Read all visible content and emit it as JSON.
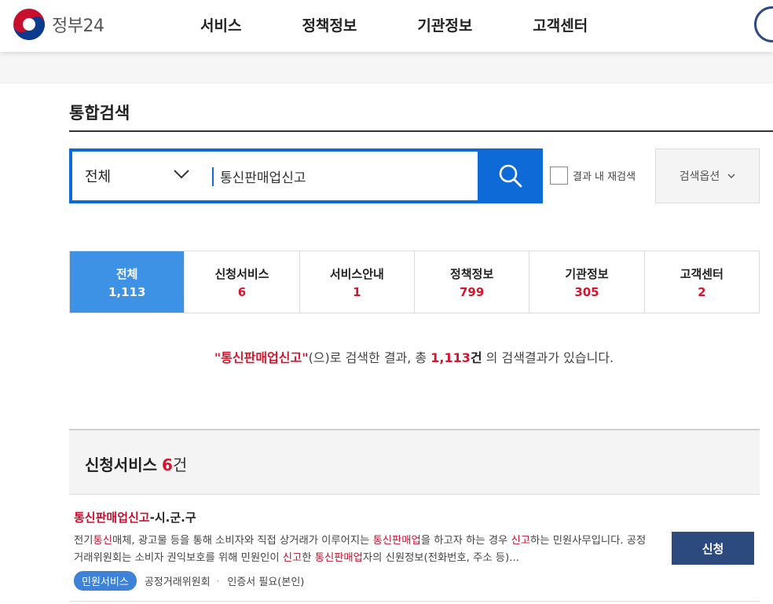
{
  "header": {
    "logo_text": "정부24",
    "nav": [
      "서비스",
      "정책정보",
      "기관정보",
      "고객센터"
    ]
  },
  "page_title": "통합검색",
  "search": {
    "category": "전체",
    "query": "통신판매업신고",
    "resrch_label": "결과 내 재검색",
    "options_label": "검색옵션"
  },
  "tabs": [
    {
      "label": "전체",
      "count": "1,113"
    },
    {
      "label": "신청서비스",
      "count": "6"
    },
    {
      "label": "서비스안내",
      "count": "1"
    },
    {
      "label": "정책정보",
      "count": "799"
    },
    {
      "label": "기관정보",
      "count": "305"
    },
    {
      "label": "고객센터",
      "count": "2"
    }
  ],
  "summary": {
    "keyword": "\"통신판매업신고\"",
    "text1": "(으)로 검색한 결과, 총 ",
    "count": "1,113",
    "unit": "건",
    "text2": " 의 검색결과가 있습니다."
  },
  "section": {
    "title": "신청서비스",
    "count": "6",
    "unit": "건"
  },
  "result": {
    "title_hl": "통신판매업신고",
    "title_rest": "-시.군.구",
    "desc": [
      {
        "t": "전기",
        "h": false
      },
      {
        "t": "통신",
        "h": true
      },
      {
        "t": "매체, 광고물 등을 통해 소비자와 직접 상거래가 이루어지는 ",
        "h": false
      },
      {
        "t": "통신판매업",
        "h": true
      },
      {
        "t": "을 하고자 하는 경우 ",
        "h": false
      },
      {
        "t": "신고",
        "h": true
      },
      {
        "t": "하는 민원사무입니다. 공정거래위원회는 소비자 권익보호를 위해 민원인이 ",
        "h": false
      },
      {
        "t": "신고",
        "h": true
      },
      {
        "t": "한 ",
        "h": false
      },
      {
        "t": "통신판매업",
        "h": true
      },
      {
        "t": "자의 신원정보(전화번호, 주소 등)...",
        "h": false
      }
    ],
    "badge": "민원서비스",
    "agency": "공정거래위원회",
    "cert": "인증서 필요(본인)",
    "apply_label": "신청"
  }
}
